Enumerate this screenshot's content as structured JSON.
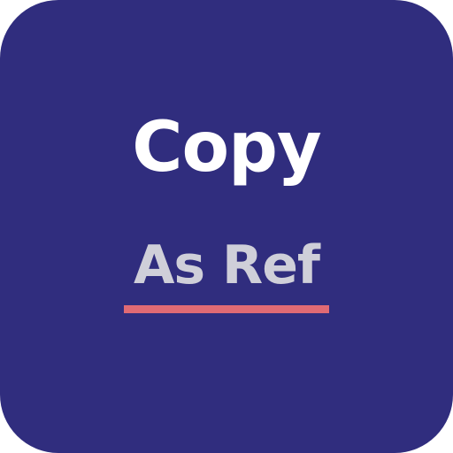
{
  "icon": {
    "title": "Copy",
    "subtitle": "As Ref",
    "colors": {
      "background": "#302D7E",
      "title": "#FFFFFF",
      "subtitle": "#CFCFD9",
      "underline": "#E06A74"
    }
  }
}
